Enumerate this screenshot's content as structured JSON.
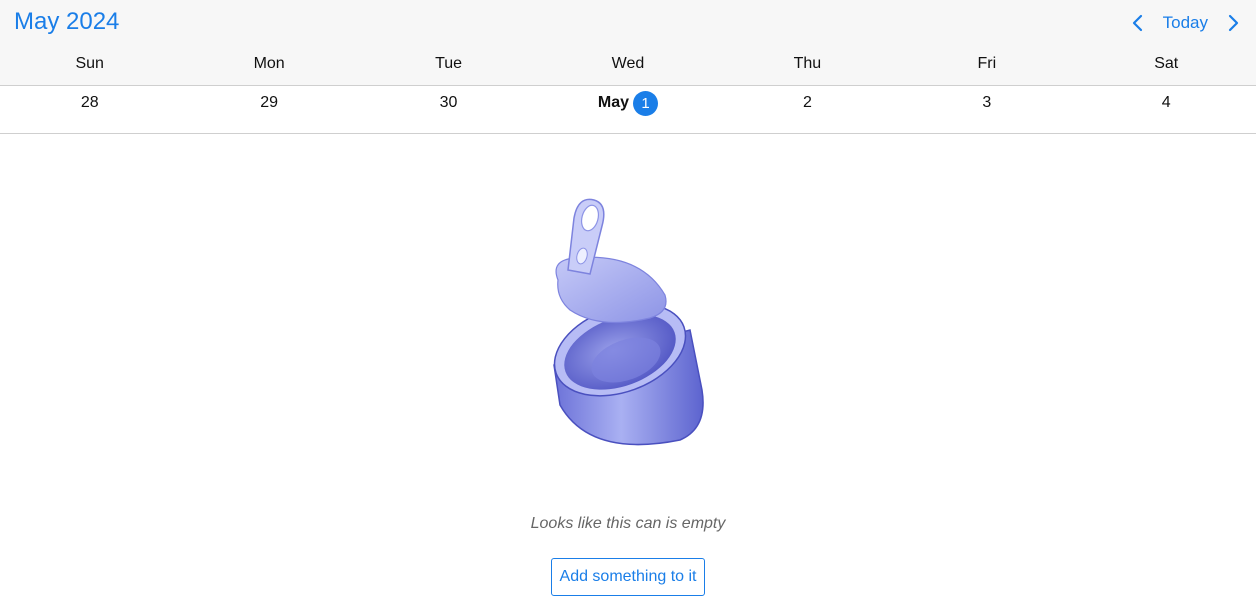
{
  "header": {
    "month_title": "May 2024",
    "today_label": "Today",
    "prev_icon": "chevron-left-icon",
    "next_icon": "chevron-right-icon",
    "accent_color": "#1a7ee8"
  },
  "weekdays": [
    "Sun",
    "Mon",
    "Tue",
    "Wed",
    "Thu",
    "Fri",
    "Sat"
  ],
  "week": {
    "days": [
      "28",
      "29",
      "30",
      "May",
      "2",
      "3",
      "4"
    ],
    "today_day": "1",
    "today_index": 3
  },
  "empty_state": {
    "illustration": "empty-can-illustration",
    "message": "Looks like this can is empty",
    "action_label": "Add something to it"
  }
}
